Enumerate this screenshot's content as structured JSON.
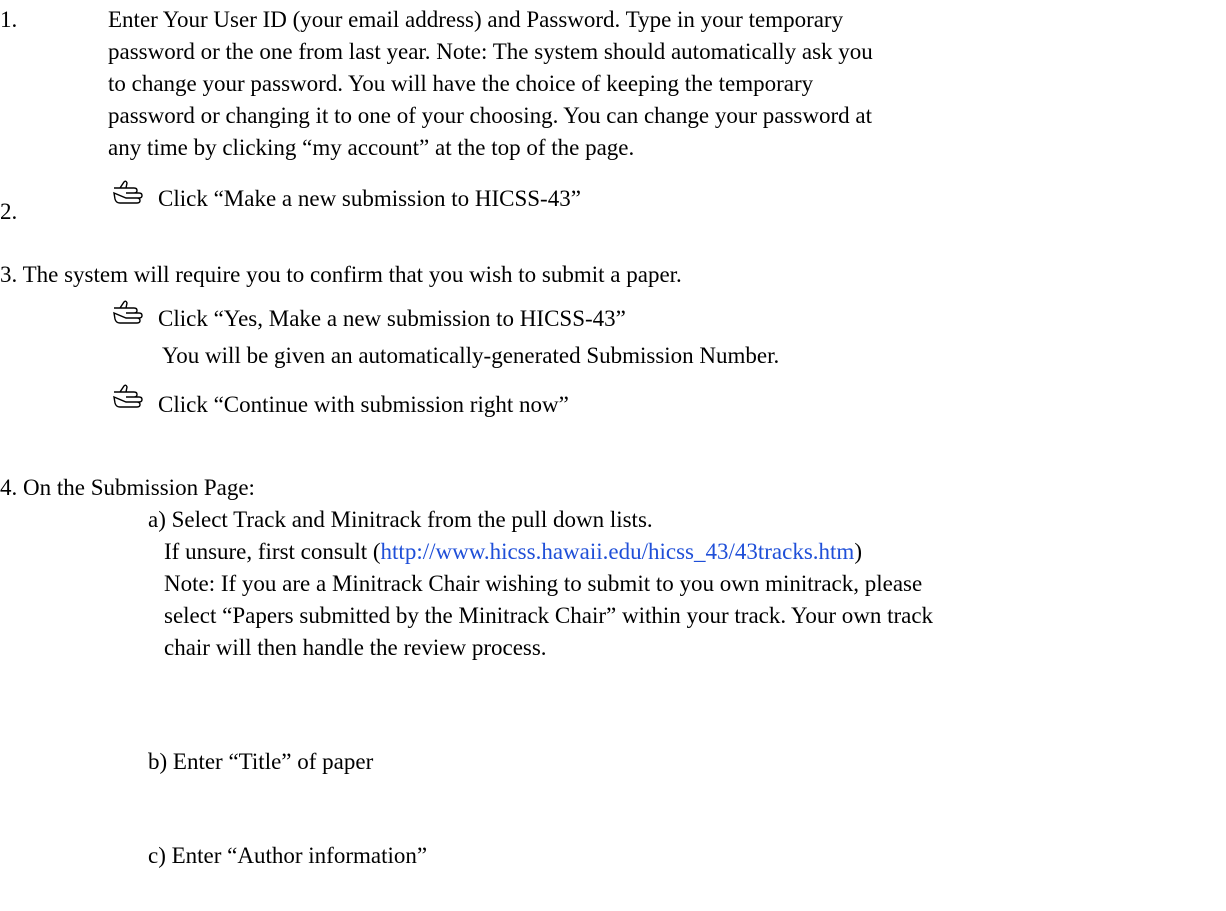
{
  "step1": {
    "number": "1.",
    "lines": [
      "Enter Your User ID (your email address) and Password.  Type in your temporary",
      "password or the one from last year. Note: The system should automatically ask you",
      "to change your password. You will have the choice of keeping the temporary",
      "password or changing it to one of your choosing. You can change your password at",
      "any time by clicking “my account” at the top of the page."
    ]
  },
  "step2": {
    "number": "2.",
    "text": "Click “Make a new submission to HICSS-43”"
  },
  "step3": {
    "text": "3. The system will require you to confirm that you wish to submit a paper.",
    "click1": "Click “Yes, Make a new submission to HICSS-43”",
    "click1_note": "You will be given an automatically-generated Submission Number.",
    "click2": "Click “Continue with submission right now”"
  },
  "step4": {
    "text": "4. On the Submission Page:",
    "a_line1": "a) Select Track and Minitrack from the pull down lists.",
    "a_line2_prefix": "If unsure, first consult (",
    "a_link": "http://www.hicss.hawaii.edu/hicss_43/43tracks.htm",
    "a_line2_suffix": ")",
    "a_note": [
      "Note: If you are a Minitrack Chair wishing to submit to you own minitrack, please",
      "select “Papers submitted by the Minitrack Chair” within your track. Your own track",
      "chair will then handle the review process."
    ],
    "b": "b) Enter “Title” of paper",
    "c": "c) Enter “Author information”"
  },
  "icons": {
    "pointer": "pointing-hand-icon"
  },
  "colors": {
    "link": "#1f4fd8"
  }
}
